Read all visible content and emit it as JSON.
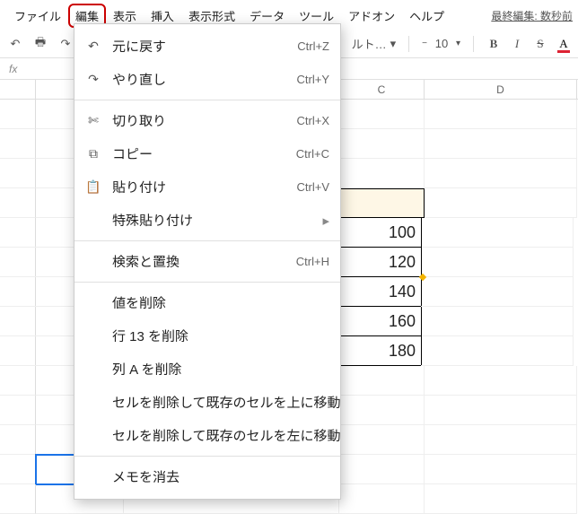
{
  "menubar": {
    "items": [
      "ファイル",
      "編集",
      "表示",
      "挿入",
      "表示形式",
      "データ",
      "ツール",
      "アドオン",
      "ヘルプ"
    ],
    "last_edit": "最終編集: 数秒前"
  },
  "toolbar": {
    "default_label": "ルト…",
    "font_size": "10"
  },
  "dropdown": {
    "undo": {
      "label": "元に戻す",
      "shortcut": "Ctrl+Z"
    },
    "redo": {
      "label": "やり直し",
      "shortcut": "Ctrl+Y"
    },
    "cut": {
      "label": "切り取り",
      "shortcut": "Ctrl+X"
    },
    "copy": {
      "label": "コピー",
      "shortcut": "Ctrl+C"
    },
    "paste": {
      "label": "貼り付け",
      "shortcut": "Ctrl+V"
    },
    "paste_sp": {
      "label": "特殊貼り付け"
    },
    "find": {
      "label": "検索と置換",
      "shortcut": "Ctrl+H"
    },
    "del_val": {
      "label": "値を削除"
    },
    "del_row": {
      "label": "行 13 を削除"
    },
    "del_col": {
      "label": "列 A を削除"
    },
    "del_up": {
      "label": "セルを削除して既存のセルを上に移動"
    },
    "del_left": {
      "label": "セルを削除して既存のセルを左に移動"
    },
    "del_memo": {
      "label": "メモを消去"
    }
  },
  "grid": {
    "columns": [
      "",
      "",
      "C",
      "D"
    ],
    "col_c_values": [
      "",
      "100",
      "120",
      "140",
      "160",
      "180"
    ]
  }
}
